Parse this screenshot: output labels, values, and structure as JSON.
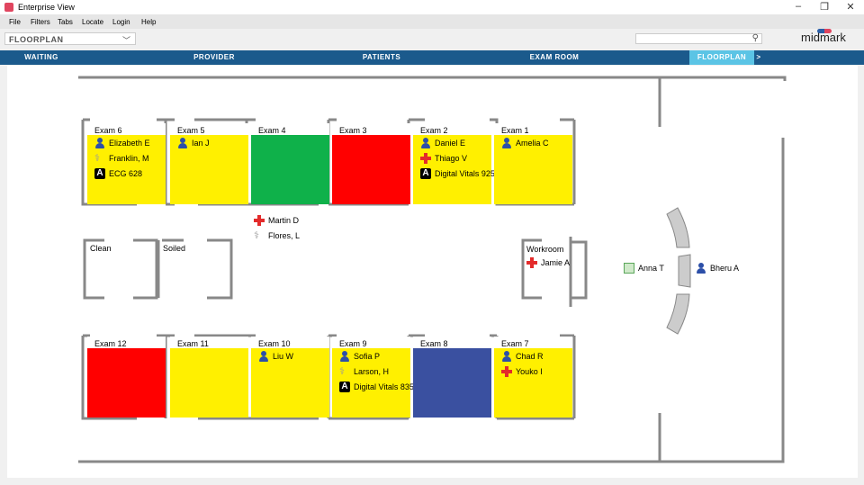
{
  "window": {
    "title": "Enterprise View",
    "controls": [
      "–",
      "❐",
      "✕"
    ]
  },
  "menu": [
    "File",
    "Filters",
    "Tabs",
    "Locate",
    "Login",
    "Help"
  ],
  "view_select": {
    "value": "FLOORPLAN"
  },
  "search": {
    "placeholder": "",
    "value": ""
  },
  "brand": "midmark",
  "tabs": [
    {
      "label": "WAITING"
    },
    {
      "label": "PROVIDER"
    },
    {
      "label": "PATIENTS"
    },
    {
      "label": "EXAM ROOM"
    },
    {
      "label": "FLOORPLAN",
      "active": true
    },
    {
      "label": ">"
    }
  ],
  "colors": {
    "yellow": "#fff000",
    "green": "#0fb14a",
    "red": "#ff0000",
    "blue": "#3a50a0",
    "tab_bar": "#1b5a8c",
    "tab_active": "#5bc4e5"
  },
  "rooms_top": [
    {
      "name": "Exam 6",
      "status": "yellow",
      "entries": [
        {
          "icon": "person-icon",
          "text": "Elizabeth E"
        },
        {
          "icon": "stethoscope-icon",
          "text": "Franklin, M"
        },
        {
          "icon": "a-badge-icon",
          "text": "ECG 628"
        }
      ]
    },
    {
      "name": "Exam 5",
      "status": "yellow",
      "entries": [
        {
          "icon": "person-icon",
          "text": "Ian J"
        }
      ]
    },
    {
      "name": "Exam 4",
      "status": "green",
      "entries": []
    },
    {
      "name": "Exam 3",
      "status": "red",
      "entries": []
    },
    {
      "name": "Exam 2",
      "status": "yellow",
      "entries": [
        {
          "icon": "person-icon",
          "text": "Daniel E"
        },
        {
          "icon": "red-cross-icon",
          "text": "Thiago V"
        },
        {
          "icon": "a-badge-icon",
          "text": "Digital Vitals 925"
        }
      ]
    },
    {
      "name": "Exam 1",
      "status": "yellow",
      "entries": [
        {
          "icon": "person-icon",
          "text": "Amelia C"
        }
      ]
    }
  ],
  "rooms_bottom": [
    {
      "name": "Exam 12",
      "status": "red",
      "entries": []
    },
    {
      "name": "Exam 11",
      "status": "yellow",
      "entries": []
    },
    {
      "name": "Exam 10",
      "status": "yellow",
      "entries": [
        {
          "icon": "person-icon",
          "text": "Liu W"
        }
      ]
    },
    {
      "name": "Exam 9",
      "status": "yellow",
      "entries": [
        {
          "icon": "person-icon",
          "text": "Sofia P"
        },
        {
          "icon": "stethoscope-icon",
          "text": "Larson, H"
        },
        {
          "icon": "a-badge-icon",
          "text": "Digital Vitals 835"
        }
      ]
    },
    {
      "name": "Exam 8",
      "status": "blue",
      "entries": []
    },
    {
      "name": "Exam 7",
      "status": "yellow",
      "entries": [
        {
          "icon": "person-icon",
          "text": "Chad R"
        },
        {
          "icon": "red-cross-icon",
          "text": "Youko I"
        }
      ]
    }
  ],
  "hallway": [
    {
      "icon": "red-cross-icon",
      "text": "Martin D"
    },
    {
      "icon": "stethoscope-icon",
      "text": "Flores, L"
    }
  ],
  "other_rooms": {
    "clean": "Clean",
    "soiled": "Soiled",
    "workroom": "Workroom"
  },
  "workroom_entry": {
    "icon": "red-cross-icon",
    "text": "Jamie A"
  },
  "reception": [
    {
      "icon": "clipboard-icon",
      "text": "Anna T"
    },
    {
      "icon": "person-icon",
      "text": "Bheru A"
    }
  ]
}
